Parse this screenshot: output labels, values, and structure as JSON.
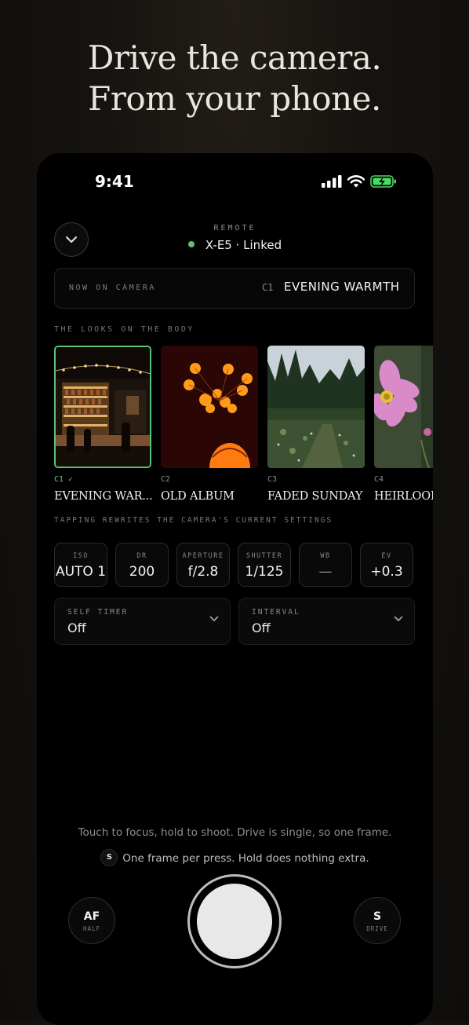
{
  "headline": {
    "line1": "Drive the camera.",
    "line2": "From your phone."
  },
  "status_bar": {
    "time": "9:41"
  },
  "header": {
    "label": "REMOTE",
    "device": "X-E5 · Linked"
  },
  "now_on_camera": {
    "label": "NOW ON CAMERA",
    "code": "C1",
    "name": "EVENING WARMTH"
  },
  "looks": {
    "section_label": "THE LOOKS ON THE BODY",
    "items": [
      {
        "code": "C1 ✓",
        "name": "EVENING WAR...",
        "selected": true
      },
      {
        "code": "C2",
        "name": "OLD ALBUM",
        "selected": false
      },
      {
        "code": "C3",
        "name": "FADED SUNDAY",
        "selected": false
      },
      {
        "code": "C4",
        "name": "HEIRLOOM",
        "selected": false
      }
    ],
    "note": "TAPPING REWRITES THE CAMERA'S CURRENT SETTINGS"
  },
  "settings": [
    {
      "label": "ISO",
      "value": "AUTO 1"
    },
    {
      "label": "DR",
      "value": "200"
    },
    {
      "label": "APERTURE",
      "value": "f/2.8"
    },
    {
      "label": "SHUTTER",
      "value": "1/125"
    },
    {
      "label": "WB",
      "value": "—"
    },
    {
      "label": "EV",
      "value": "+0.3"
    }
  ],
  "dropdowns": {
    "self_timer": {
      "label": "SELF TIMER",
      "value": "Off"
    },
    "interval": {
      "label": "INTERVAL",
      "value": "Off"
    }
  },
  "hints": {
    "line1": "Touch to focus, hold to shoot. Drive is single, so one frame.",
    "badge": "S",
    "line2": "One frame per press. Hold does nothing extra."
  },
  "controls": {
    "af": {
      "label": "AF",
      "sub": "HALF"
    },
    "drive": {
      "label": "S",
      "sub": "DRIVE"
    }
  },
  "colors": {
    "accent_green": "#5fc47a",
    "background": "#000000",
    "battery": "#4cd964"
  },
  "icons": [
    "chevron-down-icon",
    "signal-icon",
    "wifi-icon",
    "battery-charging-icon",
    "check-icon"
  ]
}
